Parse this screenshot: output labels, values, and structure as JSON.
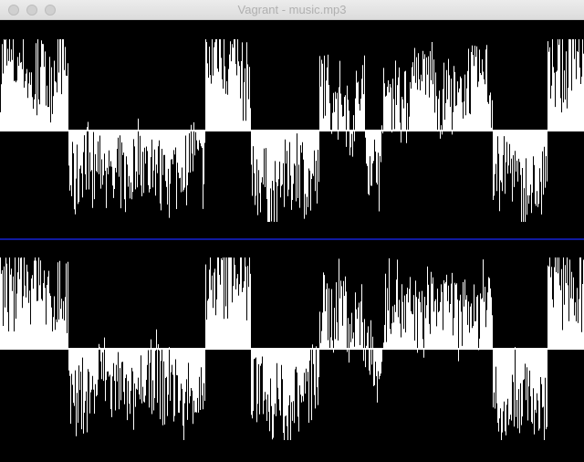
{
  "window": {
    "title": "Vagrant - music.mp3"
  },
  "colors": {
    "background": "#000000",
    "waveform": "#ffffff",
    "divider": "#1a2aff"
  },
  "icons": {
    "close": "close-button-icon",
    "minimize": "minimize-button-icon",
    "zoom": "zoom-button-icon"
  }
}
